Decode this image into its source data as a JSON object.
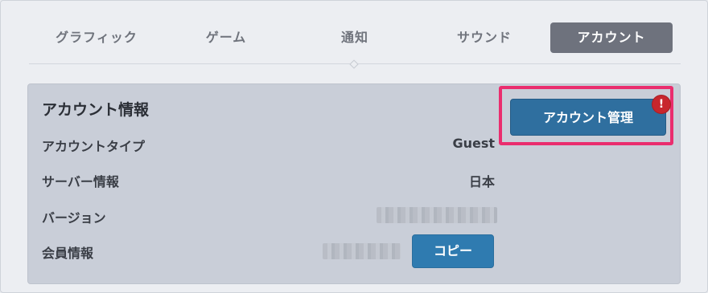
{
  "tabs": [
    {
      "label": "グラフィック"
    },
    {
      "label": "ゲーム"
    },
    {
      "label": "通知"
    },
    {
      "label": "サウンド"
    },
    {
      "label": "アカウント",
      "active": true
    }
  ],
  "panel": {
    "title": "アカウント情報",
    "rows": [
      {
        "label": "アカウントタイプ",
        "value": "Guest"
      },
      {
        "label": "サーバー情報",
        "value": "日本"
      },
      {
        "label": "バージョン",
        "value": ""
      },
      {
        "label": "会員情報",
        "value": ""
      }
    ],
    "copy_button": "コピー",
    "account_button": "アカウント管理",
    "alert_symbol": "!"
  },
  "colors": {
    "active_tab": "#6e727d",
    "button": "#2f6f9f",
    "highlight": "#ea2d6e",
    "alert": "#c8262d"
  }
}
